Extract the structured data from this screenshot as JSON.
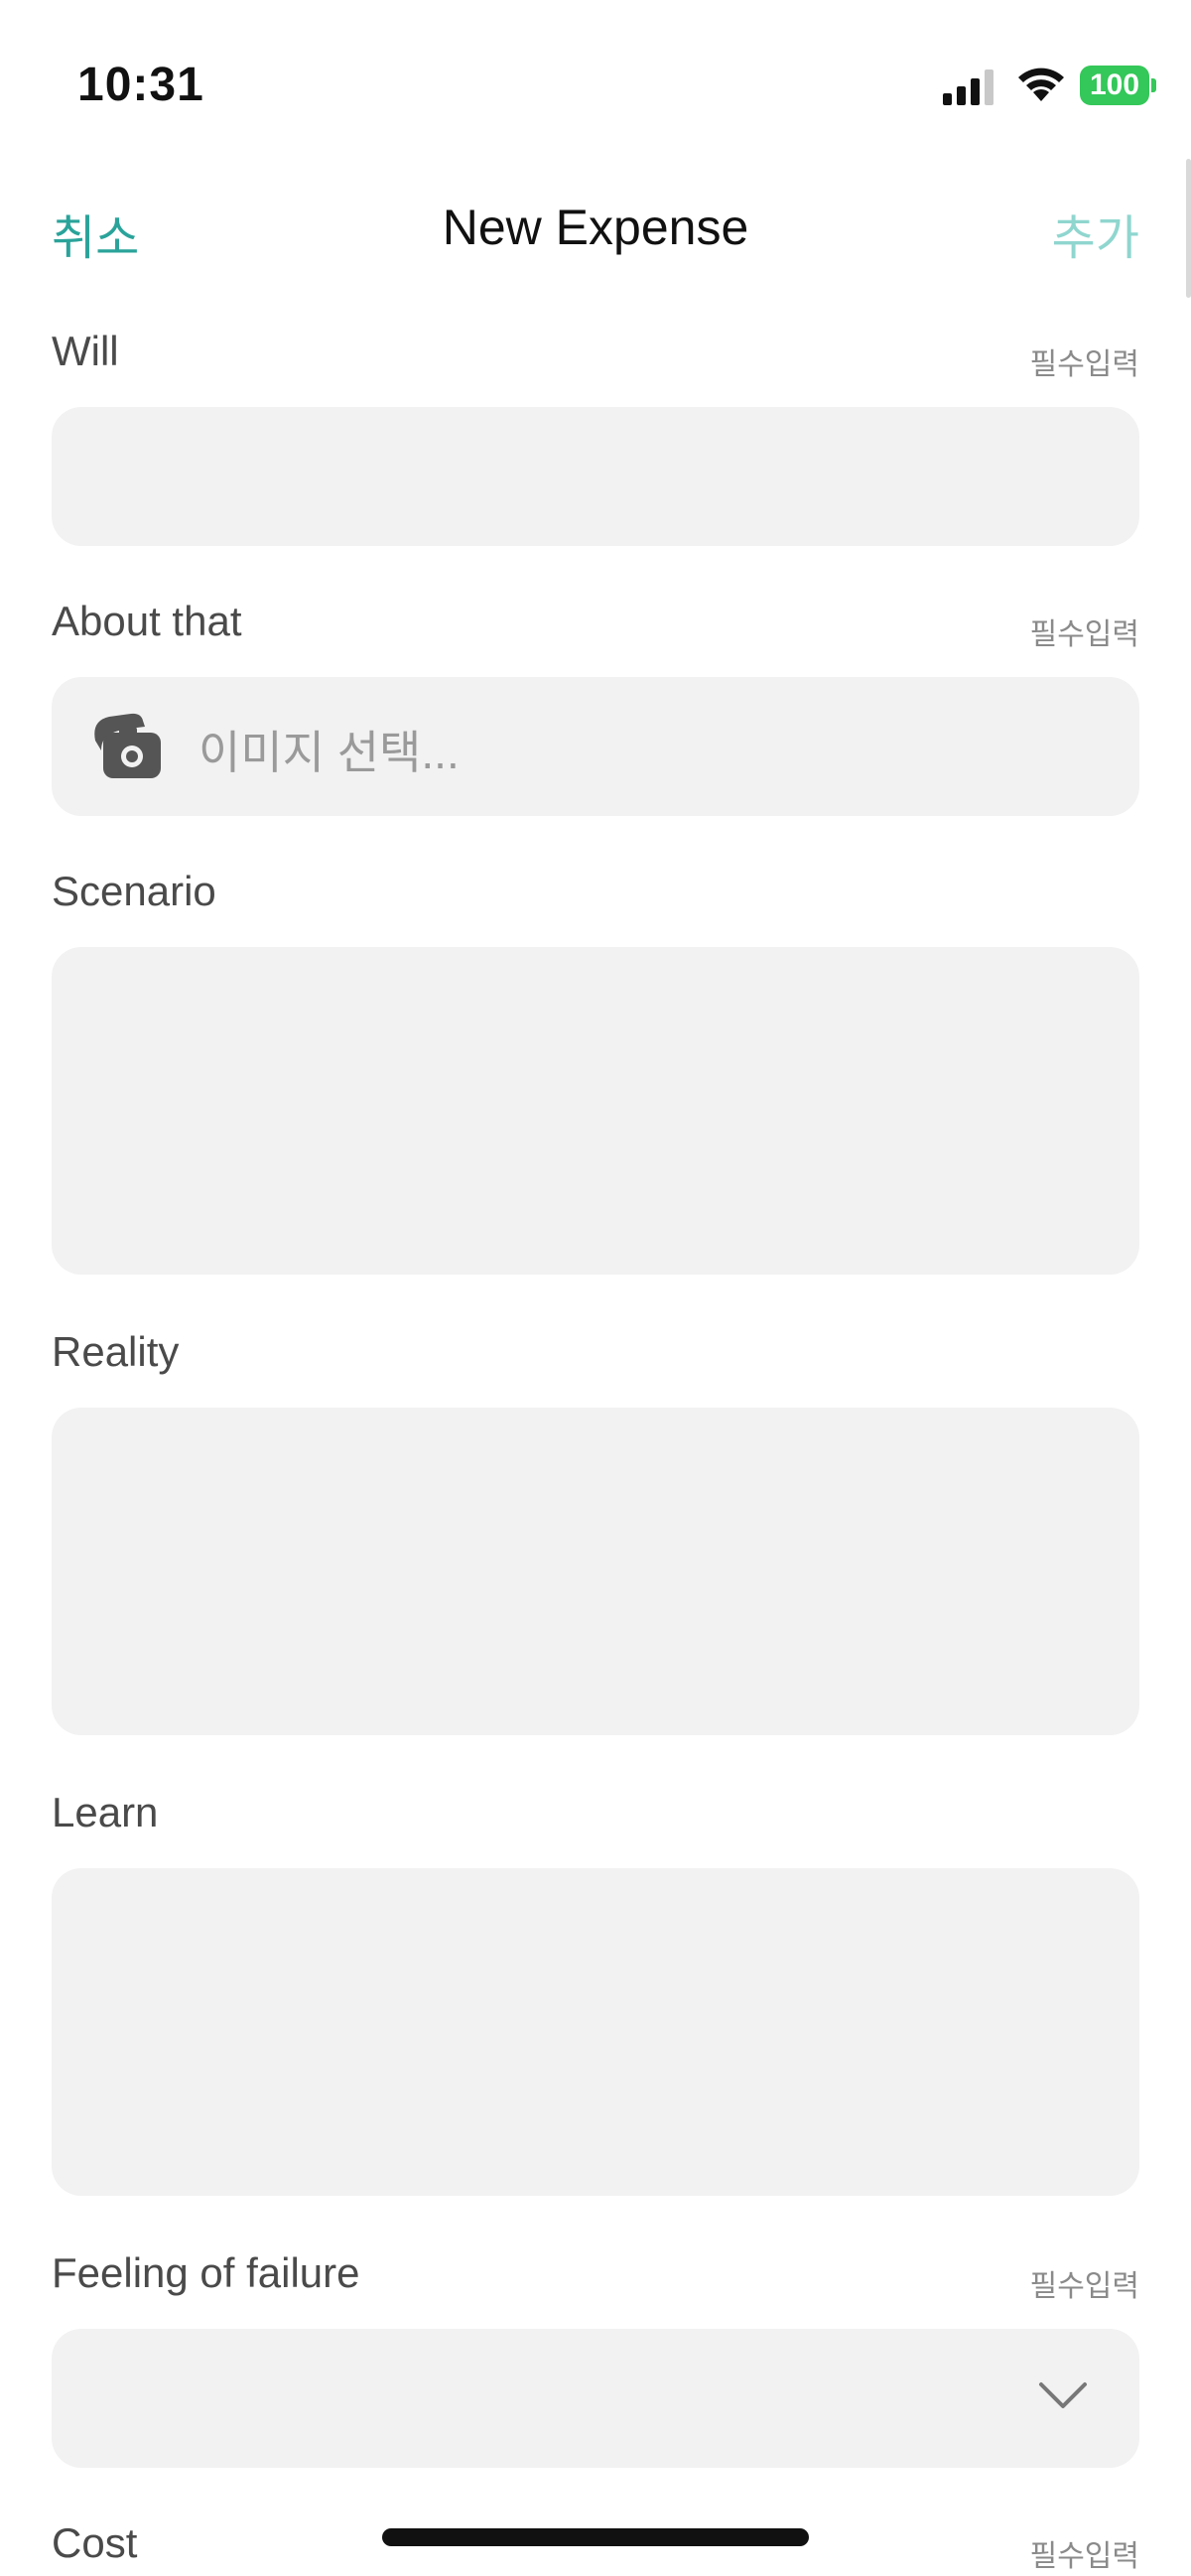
{
  "status_bar": {
    "time": "10:31",
    "battery": "100",
    "icons": [
      "signal-icon",
      "wifi-icon",
      "battery-icon"
    ],
    "battery_color": "#34c759"
  },
  "nav": {
    "cancel_label": "취소",
    "title": "New Expense",
    "add_label": "추가",
    "accent_color": "#2aa39a"
  },
  "fields": {
    "will": {
      "label": "Will",
      "required": "필수입력",
      "value": ""
    },
    "about": {
      "label": "About that",
      "required": "필수입력",
      "placeholder": "이미지 선택...",
      "icon": "camera-icon"
    },
    "scenario": {
      "label": "Scenario",
      "value": ""
    },
    "reality": {
      "label": "Reality",
      "value": ""
    },
    "learn": {
      "label": "Learn",
      "value": ""
    },
    "feeling": {
      "label": "Feeling of failure",
      "required": "필수입력",
      "value": "",
      "icon": "chevron-down-icon"
    },
    "cost": {
      "label": "Cost",
      "required": "필수입력"
    }
  }
}
